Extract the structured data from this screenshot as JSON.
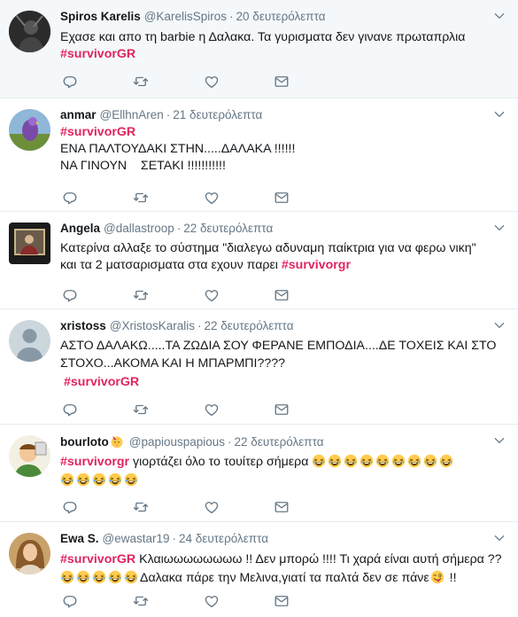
{
  "tweets": [
    {
      "name": "Spiros Karelis",
      "handle": "@KarelisSpiros",
      "time": "20 δευτερόλεπτα",
      "line1": "Εχασε και απο τη barbie η Δαλακα. Τα γυρισματα δεν γινανε πρωταπρλια",
      "tag": "#survivorGR",
      "avatar": "dark-portrait-avatar"
    },
    {
      "name": "anmar",
      "handle": "@EllhnAren",
      "time": "21 δευτερόλεπτα",
      "tag": "#survivorGR",
      "line2": "ΕΝΑ ΠΑΛΤΟΥΔΑΚΙ ΣΤΗΝ.....ΔΑΛΑΚΑ !!!!!!",
      "line3": "ΝΑ ΓΙΝΟΥΝ    ΣΕΤΑΚΙ !!!!!!!!!!!",
      "avatar": "parrot-avatar"
    },
    {
      "name": "Angela",
      "handle": "@dallastroop",
      "time": "22 δευτερόλεπτα",
      "line1": "Κατερίνα αλλαξε το σύστημα \"διαλεγω αδυναμη παίκτρια για να φερω νικη\"",
      "line2_prefix": "και τα 2 ματσαρισματα στα εχουν παρει ",
      "tag": "#survivorgr",
      "avatar": "framed-photo-avatar"
    },
    {
      "name": "xristoss",
      "handle": "@XristosKaralis",
      "time": "22 δευτερόλεπτα",
      "line1": "ΑΣΤΟ ΔΑΛΑΚΩ.....ΤΑ ΖΩΔΙΑ ΣΟΥ ΦΕΡΑΝΕ ΕΜΠΟΔΙΑ....ΔΕ ΤΟΧΕΙΣ ΚΑΙ ΣΤΟ",
      "line2": "ΣΤΟΧΟ...ΑΚΟΜΑ ΚΑΙ Η ΜΠΑΡΜΠΙ????",
      "tag": "#survivorGR",
      "avatar": "default-user-avatar"
    },
    {
      "name": "bourloto",
      "handle": "@papiouspapious",
      "time": "22 δευτερόλεπτα",
      "tag": "#survivorgr",
      "line1_suffix": " γιορτάζει όλο το τουίτερ σήμερα",
      "avatar": "cartoon-avatar",
      "name_emoji": "party-emoji",
      "laugh_count_line1": 9,
      "laugh_count_line2": 5
    },
    {
      "name": "Ewa S.",
      "handle": "@ewastar19",
      "time": "24 δευτερόλεπτα",
      "tag": "#survivorGR",
      "line1_suffix": " Κλαιωωωωωωωω !! Δεν μπορώ !!!! Τι χαρά είναι αυτή σήμερα ??",
      "line2_suffix": "Δαλακα πάρε την Μελινα,γιατί τα παλτά δεν σε πάνε",
      "line2_end": " !!",
      "avatar": "woman-portrait-avatar",
      "laugh_count_line2": 5,
      "wink_emoji": "winking-tongue-emoji"
    }
  ],
  "separator": "·",
  "icons": [
    "reply-icon",
    "retweet-icon",
    "like-icon",
    "direct-message-icon",
    "chevron-down-icon"
  ],
  "colors": {
    "hashtag": "#e0245e",
    "meta": "#657786",
    "highlight_bg": "#f5f8fa",
    "icon": "#657786"
  }
}
